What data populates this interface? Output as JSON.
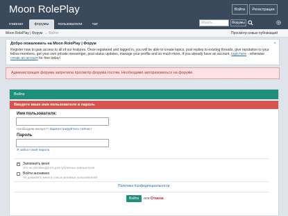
{
  "header": {
    "site_title": "Moon RolePlay",
    "login_label": "Войти",
    "register_label": "Регистрация"
  },
  "nav": {
    "tabs": [
      {
        "label": "главная"
      },
      {
        "label": "форумы"
      },
      {
        "label": "пользователи"
      },
      {
        "label": "чат"
      }
    ],
    "search_placeholder": "Искать...",
    "search_scope": "Форумы"
  },
  "breadcrumb": {
    "root": "Moon RolePlay | Форум",
    "current": "Войти",
    "new_posts": "Просмотр новых публикаций"
  },
  "welcome": {
    "title": "Добро пожаловать на Moon RolePlay | Форум",
    "text_1": "Register now to gain access to all of our features. Once registered and logged in, you will be able to create topics, post replies to existing threads, give reputation to your fellow members, get your own private messenger, post status updates, manage your profile and so much more. If you already have an account,",
    "login_link": "login here",
    "text_2": "- otherwise",
    "create_link": "create an account",
    "text_3": "for free today!",
    "close": "×"
  },
  "error_message": "Администрация форума запретила просмотр форума гостям. Необходимо авторизоваться на форуме.",
  "login_panel": {
    "header": "Войти",
    "warning": "Введите ваше имя пользователя и пароль",
    "username_label": "Имя пользователя:",
    "no_account_text": "Необходим аккаунт?",
    "register_link": "Зарегистрируйтесь сейчас!",
    "password_label": "Пароль",
    "forgot_password": "Я забыл свой пароль",
    "remember_label": "Запомнить меня",
    "remember_hint": "Это не рекомендуется для публичных компьютеров",
    "remember_checked": true,
    "anonymous_label": "Войти анонимно",
    "anonymous_hint": "Не добавлять меня в список активных пользователей",
    "anonymous_checked": false,
    "privacy_link": "Политика Конфиденциальности",
    "submit_label": "Войти",
    "or_text": "или",
    "cancel_label": "Отмена"
  },
  "colors": {
    "header_bg": "#3a4a5b",
    "accent_green": "#1e8f7c",
    "error_red": "#d9534f"
  }
}
